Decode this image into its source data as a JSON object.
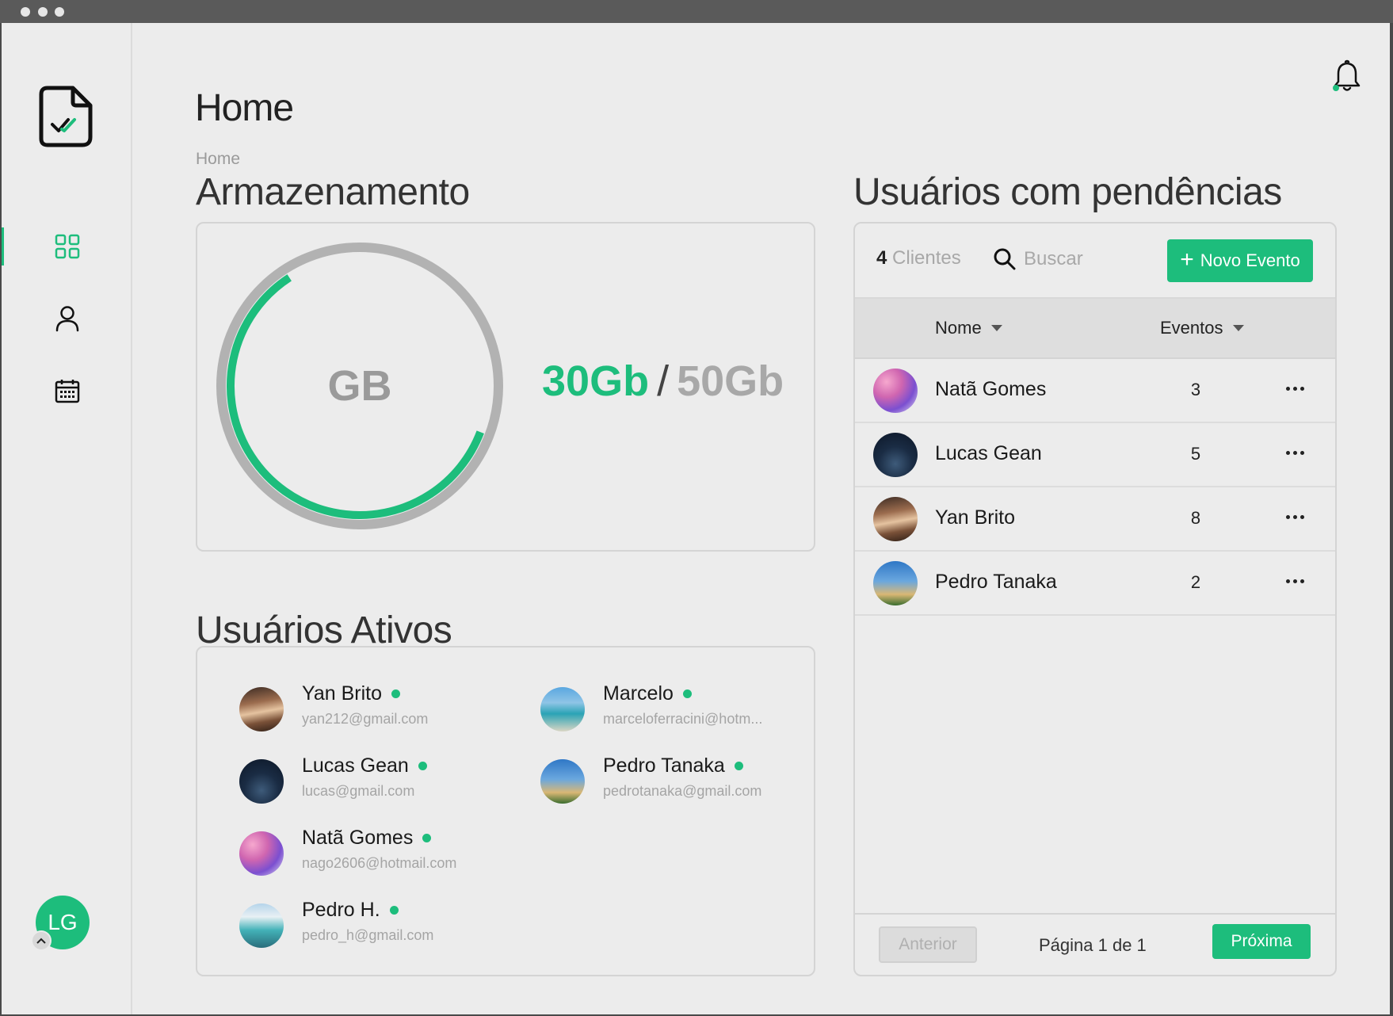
{
  "page": {
    "title": "Home",
    "breadcrumb": "Home"
  },
  "sidebar": {
    "items": [
      {
        "name": "dashboard",
        "icon": "grid-icon",
        "active": true
      },
      {
        "name": "users",
        "icon": "user-icon",
        "active": false
      },
      {
        "name": "calendar",
        "icon": "calendar-icon",
        "active": false
      }
    ],
    "user_initials": "LG"
  },
  "storage": {
    "title": "Armazenamento",
    "gauge_label": "GB",
    "used": "30Gb",
    "separator": "/",
    "total": "50Gb",
    "used_fraction": 0.6
  },
  "active_users": {
    "title": "Usuários Ativos",
    "users": [
      {
        "name": "Yan Brito",
        "email": "yan212@gmail.com",
        "avatar": "yan"
      },
      {
        "name": "Marcelo",
        "email": "marceloferracini@hotm...",
        "avatar": "marcelo"
      },
      {
        "name": "Lucas Gean",
        "email": "lucas@gmail.com",
        "avatar": "lucas"
      },
      {
        "name": "Pedro Tanaka",
        "email": "pedrotanaka@gmail.com",
        "avatar": "pedro-t"
      },
      {
        "name": "Natã Gomes",
        "email": "nago2606@hotmail.com",
        "avatar": "nata"
      },
      {
        "name": "Pedro H.",
        "email": "pedro_h@gmail.com",
        "avatar": "pedro-h"
      }
    ]
  },
  "pending": {
    "title": "Usuários com pendências",
    "count_number": "4",
    "count_label": "Clientes",
    "search_placeholder": "Buscar",
    "new_event_label": "Novo Evento",
    "columns": {
      "name": "Nome",
      "events": "Eventos"
    },
    "rows": [
      {
        "name": "Natã Gomes",
        "events": "3",
        "avatar": "nata"
      },
      {
        "name": "Lucas Gean",
        "events": "5",
        "avatar": "lucas"
      },
      {
        "name": "Yan Brito",
        "events": "8",
        "avatar": "yan"
      },
      {
        "name": "Pedro Tanaka",
        "events": "2",
        "avatar": "pedro-t"
      }
    ],
    "pagination": {
      "prev_label": "Anterior",
      "page_info": "Página 1 de 1",
      "next_label": "Próxima"
    }
  },
  "colors": {
    "accent": "#1dbd7c",
    "background": "#ececec",
    "muted_text": "#a8a8a8"
  }
}
